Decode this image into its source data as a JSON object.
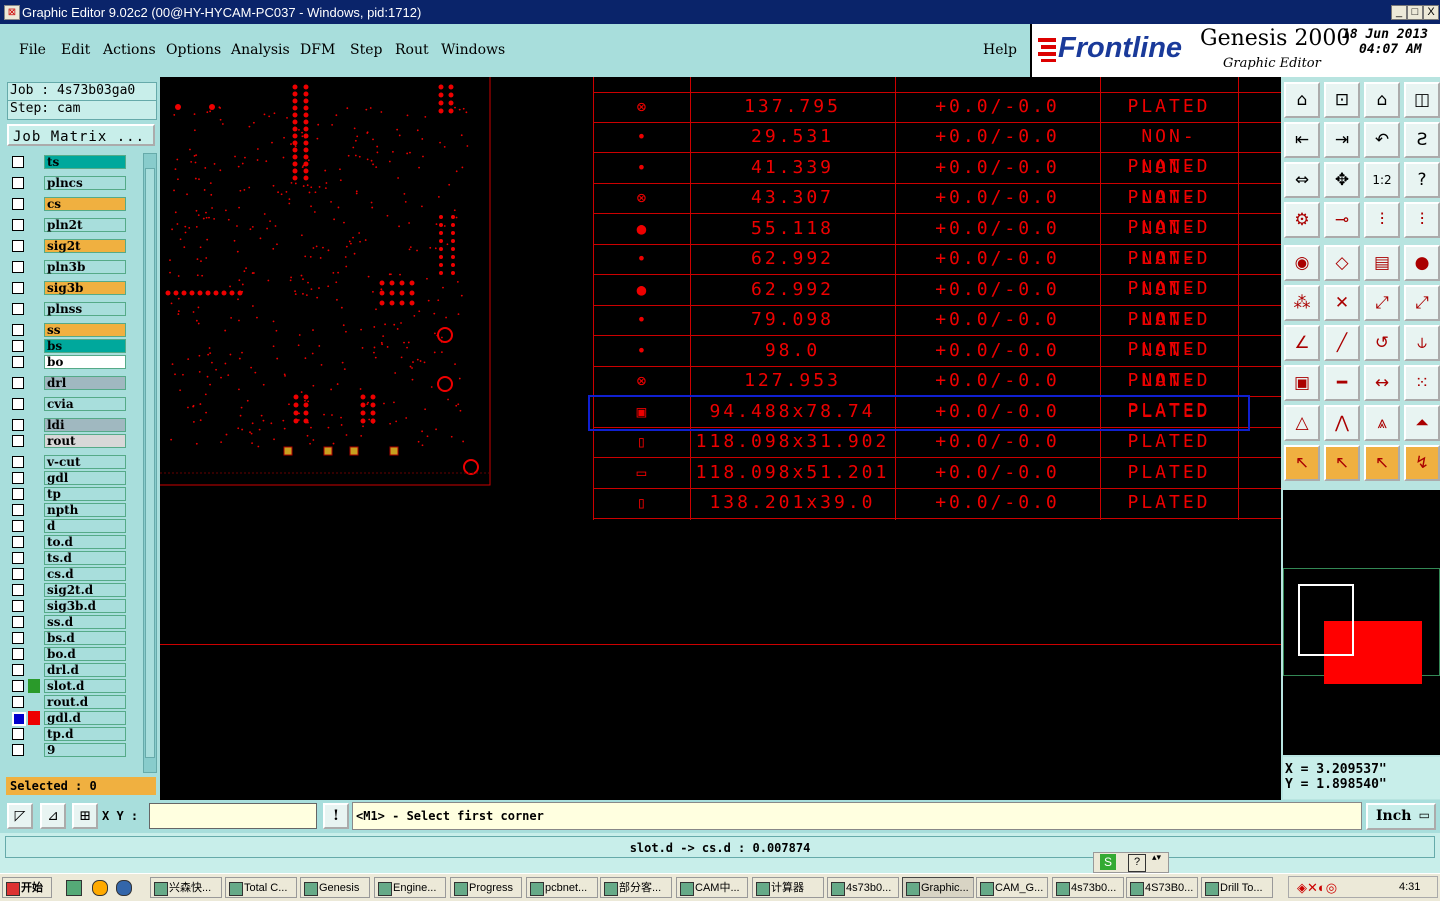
{
  "window": {
    "title": "Graphic Editor 9.02c2 (00@HY-HYCAM-PC037 - Windows, pid:1712)",
    "min": "_",
    "max": "□",
    "close": "X"
  },
  "menu": [
    "File",
    "Edit",
    "Actions",
    "Options",
    "Analysis",
    "DFM",
    "Step",
    "Rout",
    "Windows"
  ],
  "help": "Help",
  "brand": {
    "logo": "Frontline",
    "product": "Genesis 2000",
    "subtitle": "Graphic Editor",
    "date": "18 Jun 2013",
    "time": "04:07 AM"
  },
  "job": {
    "job_line": "Job : 4s73b03ga0",
    "step_line": "Step: cam",
    "matrix_button": "Job Matrix ..."
  },
  "layers": [
    {
      "name": "ts",
      "color": "#00a89c"
    },
    {
      "name": "plncs",
      "color": "#a8dedc"
    },
    {
      "name": "cs",
      "color": "#f0b040"
    },
    {
      "name": "pln2t",
      "color": "#a8dedc"
    },
    {
      "name": "sig2t",
      "color": "#f0b040"
    },
    {
      "name": "pln3b",
      "color": "#a8dedc"
    },
    {
      "name": "sig3b",
      "color": "#f0b040"
    },
    {
      "name": "plnss",
      "color": "#a8dedc"
    },
    {
      "name": "ss",
      "color": "#f0b040"
    },
    {
      "name": "bs",
      "color": "#00a89c"
    },
    {
      "name": "bo",
      "color": "#ffffff"
    },
    {
      "name": "drl",
      "color": "#a0b8c0"
    },
    {
      "name": "cvia",
      "color": "#a8dedc"
    },
    {
      "name": "ldi",
      "color": "#a0b8c0"
    },
    {
      "name": "rout",
      "color": "#d8d8d8"
    },
    {
      "name": "v-cut",
      "color": "#a8dedc"
    },
    {
      "name": "gdl",
      "color": "#a8dedc"
    },
    {
      "name": "tp",
      "color": "#a8dedc"
    },
    {
      "name": "npth",
      "color": "#a8dedc"
    },
    {
      "name": "d",
      "color": "#a8dedc"
    },
    {
      "name": "to.d",
      "color": "#a8dedc"
    },
    {
      "name": "ts.d",
      "color": "#a8dedc"
    },
    {
      "name": "cs.d",
      "color": "#a8dedc"
    },
    {
      "name": "sig2t.d",
      "color": "#a8dedc"
    },
    {
      "name": "sig3b.d",
      "color": "#a8dedc"
    },
    {
      "name": "ss.d",
      "color": "#a8dedc"
    },
    {
      "name": "bs.d",
      "color": "#a8dedc"
    },
    {
      "name": "bo.d",
      "color": "#a8dedc"
    },
    {
      "name": "drl.d",
      "color": "#a8dedc"
    },
    {
      "name": "slot.d",
      "color": "#a8dedc"
    },
    {
      "name": "rout.d",
      "color": "#a8dedc"
    },
    {
      "name": "gdl.d",
      "color": "#a8dedc"
    },
    {
      "name": "tp.d",
      "color": "#a8dedc"
    },
    {
      "name": "9",
      "color": "#a8dedc"
    }
  ],
  "selected": "Selected : 0",
  "drill_table": [
    {
      "symbol": "⊗",
      "size": "137.795",
      "tol": "+0.0/-0.0",
      "type": "PLATED"
    },
    {
      "symbol": "•",
      "size": "29.531",
      "tol": "+0.0/-0.0",
      "type": "NON-PLATED"
    },
    {
      "symbol": "•",
      "size": "41.339",
      "tol": "+0.0/-0.0",
      "type": "NON-PLATED"
    },
    {
      "symbol": "⊗",
      "size": "43.307",
      "tol": "+0.0/-0.0",
      "type": "NON-PLATED"
    },
    {
      "symbol": "●",
      "size": "55.118",
      "tol": "+0.0/-0.0",
      "type": "NON-PLATED"
    },
    {
      "symbol": "•",
      "size": "62.992",
      "tol": "+0.0/-0.0",
      "type": "NON-PLATED"
    },
    {
      "symbol": "●",
      "size": "62.992",
      "tol": "+0.0/-0.0",
      "type": "NON-PLATED"
    },
    {
      "symbol": "•",
      "size": "79.098",
      "tol": "+0.0/-0.0",
      "type": "NON-PLATED"
    },
    {
      "symbol": "•",
      "size": "98.0",
      "tol": "+0.0/-0.0",
      "type": "NON-PLATED"
    },
    {
      "symbol": "⊗",
      "size": "127.953",
      "tol": "+0.0/-0.0",
      "type": "NON-PLATED"
    },
    {
      "symbol": "▣",
      "size": "94.488x78.74",
      "tol": "+0.0/-0.0",
      "type": "PLATED"
    },
    {
      "symbol": "▯",
      "size": "118.098x31.902",
      "tol": "+0.0/-0.0",
      "type": "PLATED"
    },
    {
      "symbol": "▭",
      "size": "118.098x51.201",
      "tol": "+0.0/-0.0",
      "type": "PLATED"
    },
    {
      "symbol": "▯",
      "size": "138.201x39.0",
      "tol": "+0.0/-0.0",
      "type": "PLATED"
    }
  ],
  "coords": {
    "x": "X = 3.209537\"",
    "y": "Y = 1.898540\""
  },
  "command": {
    "xy_label": "X Y :",
    "xy_value": "",
    "prompt": "<M1> - Select first corner",
    "units": "Inch"
  },
  "status": "slot.d -> cs.d : 0.007874",
  "taskbar": {
    "start": "开始",
    "clock": "4:31",
    "tasks": [
      "兴森快...",
      "Total C...",
      "Genesis",
      "Engine...",
      "Progress",
      "pcbnet...",
      "部分客...",
      "CAM中...",
      "计算器",
      "4s73b0...",
      "Graphic...",
      "CAM_G...",
      "4s73b0...",
      "4S73B0...",
      "Drill To..."
    ]
  }
}
